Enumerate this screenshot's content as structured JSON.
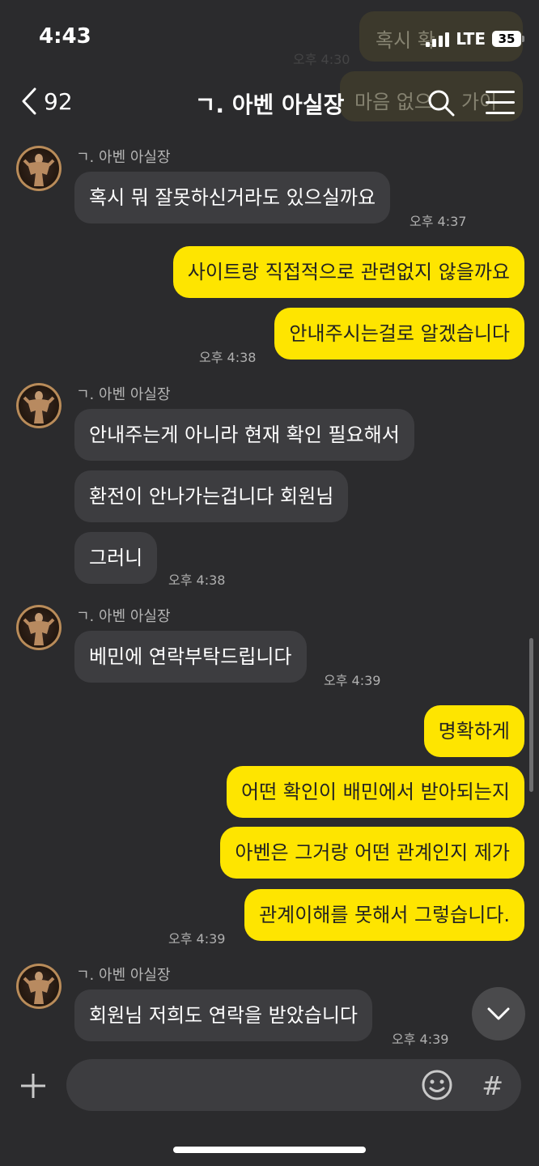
{
  "status_bar": {
    "time": "4:43",
    "network": "LTE",
    "battery": "35"
  },
  "ghost": {
    "line1": "혹시 확",
    "line2": "마음 없으",
    "line3": "가이",
    "time1": "오후 4:30"
  },
  "header": {
    "back_count": "92",
    "title": "ㄱ. 아벤 아실장"
  },
  "messages": [
    {
      "sender": "ㄱ. 아벤 아실장",
      "text": "혹시 뭐 잘못하신거라도 있으실까요",
      "time": "오후 4:37"
    },
    {
      "text": "사이트랑 직접적으로 관련없지 않을까요"
    },
    {
      "text": "안내주시는걸로 알겠습니다",
      "time": "오후 4:38"
    },
    {
      "sender": "ㄱ. 아벤 아실장",
      "text": "안내주는게 아니라 현재 확인 필요해서"
    },
    {
      "text": "환전이 안나가는겁니다 회원님"
    },
    {
      "text": "그러니",
      "time": "오후 4:38"
    },
    {
      "sender": "ㄱ. 아벤 아실장",
      "text": "베민에 연락부탁드립니다",
      "time": "오후 4:39"
    },
    {
      "text": "명확하게"
    },
    {
      "text": "어떤 확인이 배민에서 받아되는지"
    },
    {
      "text": "아벤은 그거랑 어떤 관계인지 제가"
    },
    {
      "text": "관계이해를 못해서 그렇습니다.",
      "time": "오후 4:39"
    },
    {
      "sender": "ㄱ. 아벤 아실장",
      "text": "회원님 저희도 연락을 받았습니다",
      "time": "오후 4:39"
    }
  ],
  "composer": {
    "placeholder": "",
    "hash": "#"
  },
  "colors": {
    "background": "#2b2b2d",
    "incoming": "#3d3d40",
    "outgoing": "#fee500"
  }
}
